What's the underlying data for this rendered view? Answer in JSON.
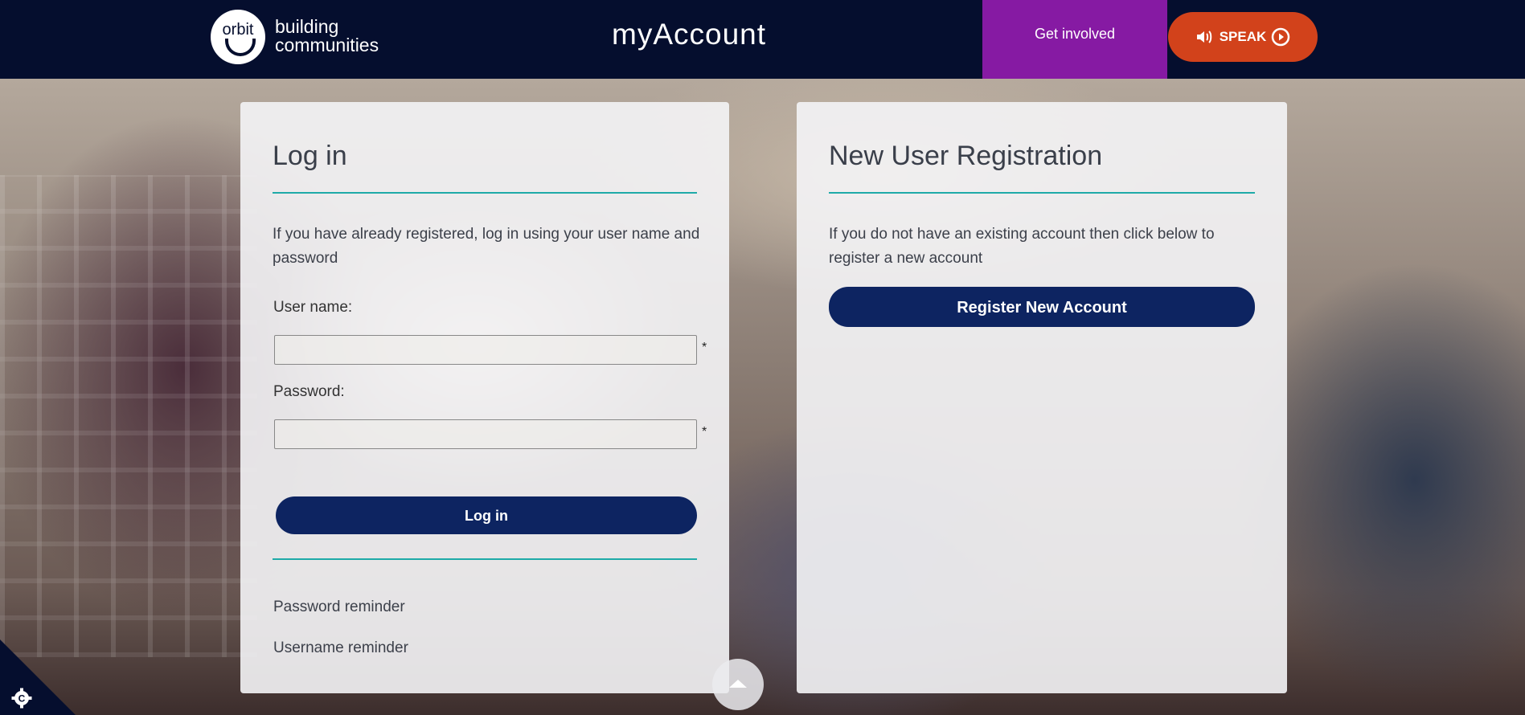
{
  "header": {
    "logo_circle_text": "orbit",
    "logo_line1": "building",
    "logo_line2": "communities",
    "app_title": "myAccount",
    "get_involved_label": "Get involved",
    "speak_label": "SPEAK",
    "background_color": "#050e2e",
    "get_involved_color": "#861aa3",
    "speak_color": "#d2421b"
  },
  "login": {
    "title": "Log in",
    "intro": "If you have already registered, log in using your user name and password",
    "username_label": "User name:",
    "username_value": "",
    "password_label": "Password:",
    "password_value": "",
    "required_marker": "*",
    "login_button": "Log in",
    "links": [
      "Password reminder",
      "Username reminder"
    ]
  },
  "register": {
    "title": "New User Registration",
    "intro": "If you do not have an existing account then click below to register a new account",
    "register_button": "Register New Account"
  },
  "colors": {
    "accent_rule": "#1eaaa8",
    "button": "#0d2461"
  },
  "icons": {
    "speaker": "speaker-icon",
    "play": "play-circle-icon",
    "scroll_top": "chevron-up-icon",
    "cookie": "cookie-settings-icon"
  }
}
